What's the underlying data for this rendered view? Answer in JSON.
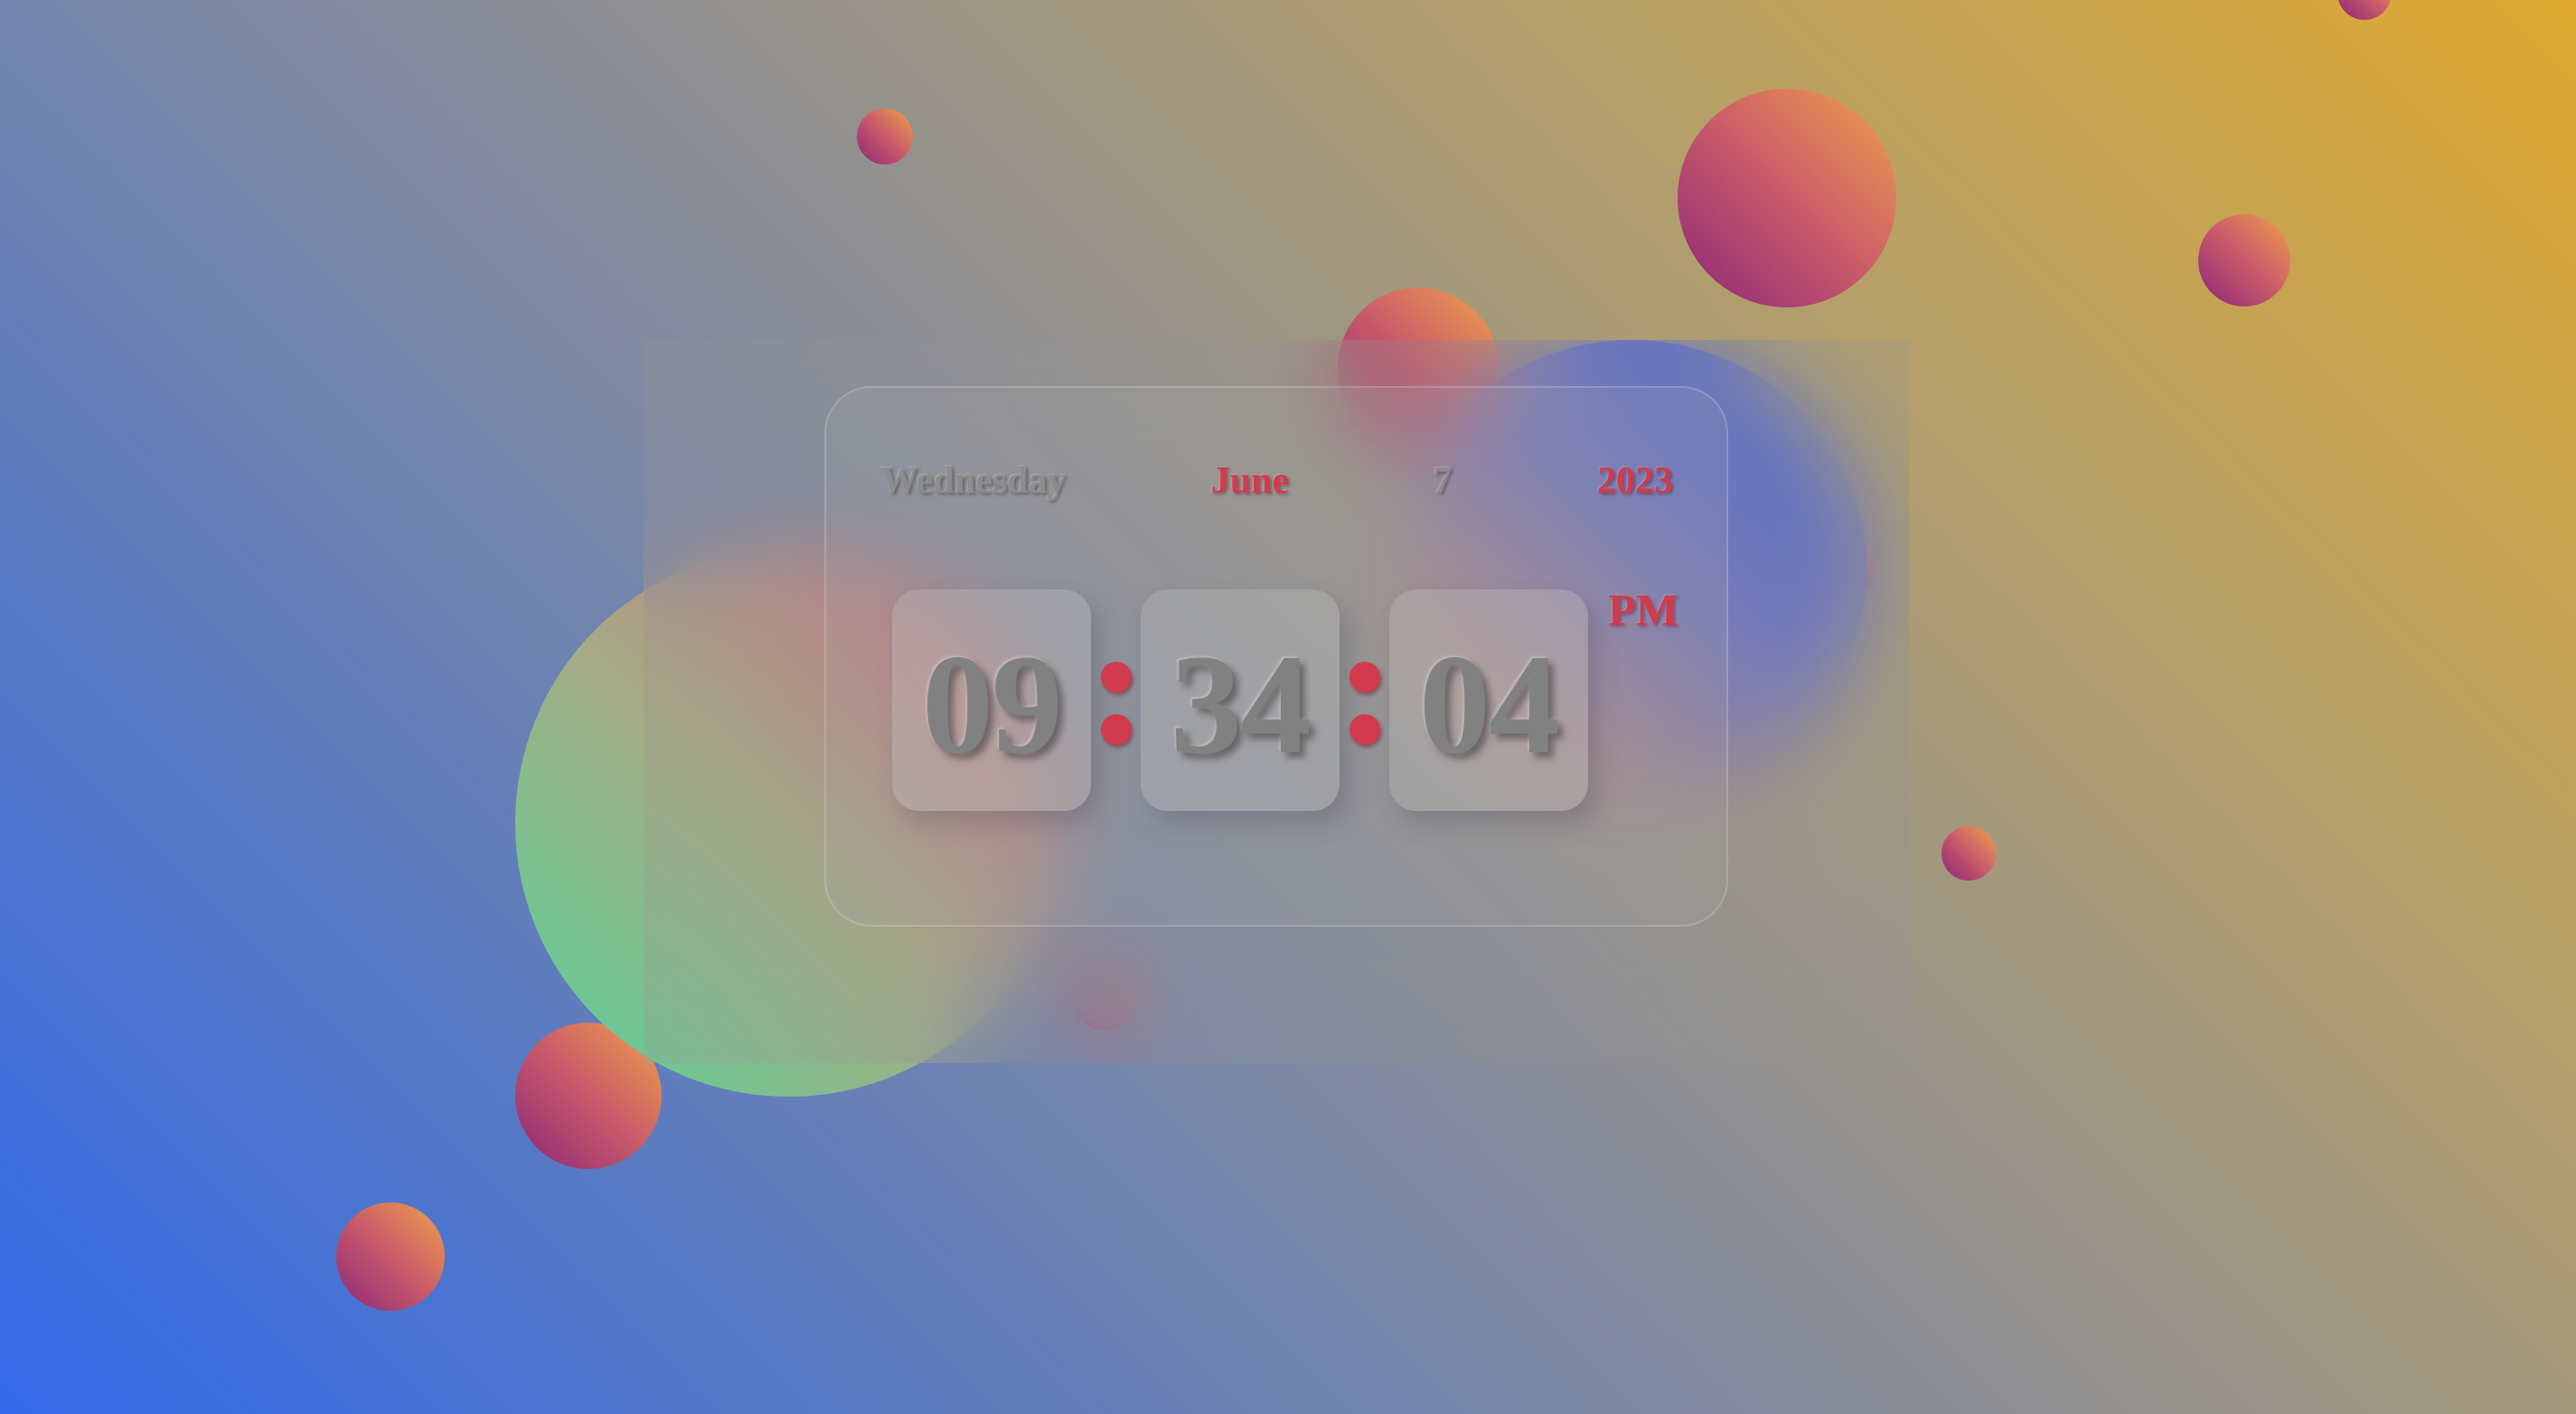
{
  "clock": {
    "day_name": "Wednesday",
    "month": "June",
    "day_number": "7",
    "year": "2023",
    "hours": "09",
    "minutes": "34",
    "seconds": "04",
    "meridiem": "PM"
  },
  "colors": {
    "accent": "#d23a4e",
    "digit_text": "#818181",
    "background_start": "#3369ea",
    "background_end": "#e0a92f",
    "orb_start": "#8b2678",
    "orb_end": "#f0a24a"
  }
}
